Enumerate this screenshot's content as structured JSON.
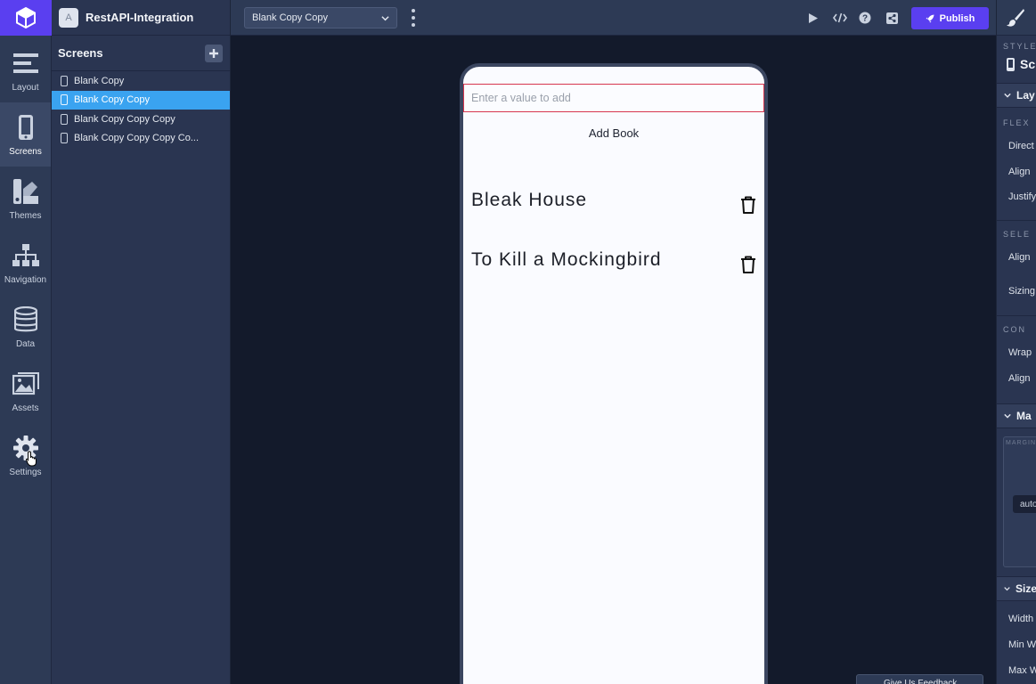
{
  "app": {
    "name": "RestAPI-Integration",
    "badge": "A"
  },
  "rail": {
    "items": [
      {
        "label": "Layout",
        "icon": "layout-icon"
      },
      {
        "label": "Screens",
        "icon": "phone-icon"
      },
      {
        "label": "Themes",
        "icon": "themes-icon"
      },
      {
        "label": "Navigation",
        "icon": "navigation-icon"
      },
      {
        "label": "Data",
        "icon": "database-icon"
      },
      {
        "label": "Assets",
        "icon": "image-icon"
      },
      {
        "label": "Settings",
        "icon": "gear-icon"
      }
    ],
    "active": "Screens"
  },
  "screens_panel": {
    "title": "Screens",
    "items": [
      {
        "label": "Blank Copy",
        "selected": false
      },
      {
        "label": "Blank Copy Copy",
        "selected": true
      },
      {
        "label": "Blank Copy Copy Copy",
        "selected": false
      },
      {
        "label": "Blank Copy Copy Copy Co...",
        "selected": false
      }
    ]
  },
  "topbar": {
    "selected_screen": "Blank Copy Copy",
    "publish_label": "Publish"
  },
  "device": {
    "input_placeholder": "Enter a value to add",
    "add_button_label": "Add Book",
    "books": [
      {
        "title": "Bleak House"
      },
      {
        "title": "To Kill a Mockingbird"
      }
    ]
  },
  "right_panel": {
    "style_label": "STYLE",
    "component_name": "Sc",
    "sections": {
      "layout": "Lay",
      "margin": "Ma",
      "size": "Size"
    },
    "flex_label": "FLEX",
    "direction_label": "Direct",
    "align_label": "Align",
    "justify_label": "Justify",
    "self_label": "SELE",
    "self_align_label": "Align",
    "sizing_label": "Sizing",
    "content_label": "CON",
    "wrap_label": "Wrap",
    "content_align_label": "Align",
    "margin_small_label": "MARGIN",
    "margin_value": "auto",
    "width_label": "Width",
    "min_width_label": "Min W",
    "max_width_label": "Max W"
  },
  "feedback_label": "Give Us Feedback",
  "colors": {
    "accent": "#5a3ff0",
    "selected": "#3aa3f0",
    "input_border": "#d7364f"
  }
}
